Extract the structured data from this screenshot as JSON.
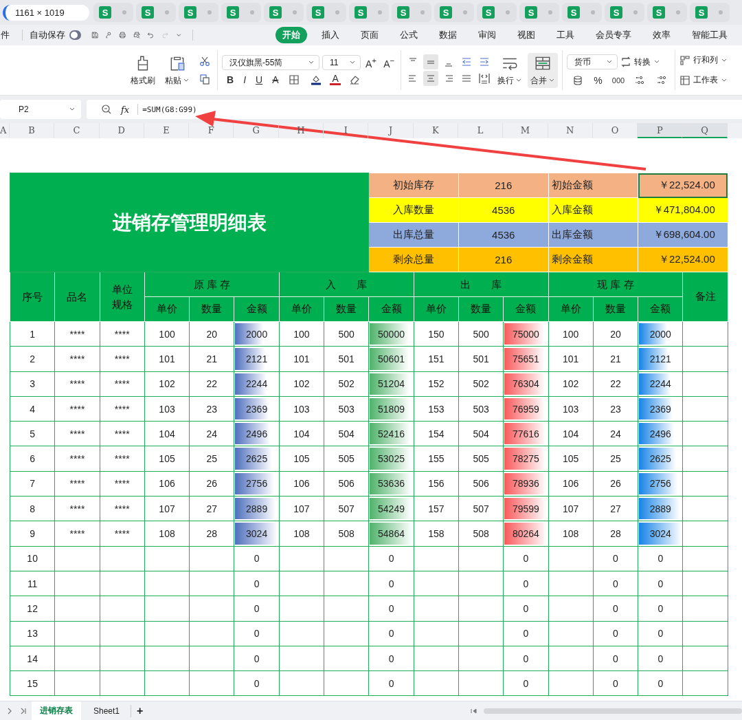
{
  "size_label": "1161 × 1019",
  "browser_tabs": [
    {
      "badge": "S"
    },
    {
      "badge": "S"
    },
    {
      "badge": "S"
    },
    {
      "badge": "S"
    },
    {
      "badge": "S"
    },
    {
      "badge": "S"
    },
    {
      "badge": "S"
    },
    {
      "badge": "S"
    },
    {
      "badge": "S"
    },
    {
      "badge": "S"
    },
    {
      "badge": "S"
    },
    {
      "badge": "S"
    },
    {
      "badge": "S"
    },
    {
      "badge": "S"
    },
    {
      "badge": "S"
    }
  ],
  "file_menu": "件",
  "autosave": {
    "label": "自动保存",
    "on": false
  },
  "menu_tabs": [
    {
      "label": "开始",
      "selected": true
    },
    {
      "label": "插入",
      "selected": false
    },
    {
      "label": "页面",
      "selected": false
    },
    {
      "label": "公式",
      "selected": false
    },
    {
      "label": "数据",
      "selected": false
    },
    {
      "label": "审阅",
      "selected": false
    },
    {
      "label": "视图",
      "selected": false
    },
    {
      "label": "工具",
      "selected": false
    },
    {
      "label": "会员专享",
      "selected": false
    },
    {
      "label": "效率",
      "selected": false
    },
    {
      "label": "智能工具",
      "selected": false
    }
  ],
  "ribbon": {
    "format_painter": "格式刷",
    "paste": "粘贴",
    "font": {
      "family": "汉仪旗黑-55简",
      "size": "11",
      "grow": "A$^{+}$",
      "shrink": "A$^{−}$",
      "bold": "B",
      "italic": "I",
      "underline": "U",
      "strike": "A",
      "color_letter": "A"
    },
    "vertical_align": [
      {
        "selected": false
      },
      {
        "selected": true
      },
      {
        "selected": false
      }
    ],
    "horizontal_align": [
      {
        "selected": false
      },
      {
        "selected": true
      },
      {
        "selected": false
      },
      {
        "selected": false
      }
    ],
    "wrap": "换行",
    "merge": {
      "label": "合并",
      "active": true
    },
    "number": {
      "format": "货币",
      "convert": "转换",
      "percent": "%",
      "thousands": "000"
    },
    "cells": [
      "行和列",
      "工作表"
    ]
  },
  "formula_bar": {
    "name_box": "P2",
    "fx": "fx",
    "formula": "=SUM(G8:G99)"
  },
  "column_headers": [
    {
      "label": "A",
      "selected": false
    },
    {
      "label": "B",
      "selected": false
    },
    {
      "label": "C",
      "selected": false
    },
    {
      "label": "D",
      "selected": false
    },
    {
      "label": "E",
      "selected": false
    },
    {
      "label": "F",
      "selected": false
    },
    {
      "label": "G",
      "selected": false
    },
    {
      "label": "H",
      "selected": false
    },
    {
      "label": "I",
      "selected": false
    },
    {
      "label": "J",
      "selected": false
    },
    {
      "label": "K",
      "selected": false
    },
    {
      "label": "L",
      "selected": false
    },
    {
      "label": "M",
      "selected": false
    },
    {
      "label": "N",
      "selected": false
    },
    {
      "label": "O",
      "selected": false
    },
    {
      "label": "P",
      "selected": true
    },
    {
      "label": "Q",
      "selected": true
    }
  ],
  "title": "进销存管理明细表",
  "summary": [
    {
      "label": "初始库存",
      "value": "216",
      "amount_label": "初始金额",
      "amount": "￥22,524.00",
      "color": "#f4b183",
      "selected": true
    },
    {
      "label": "入库数量",
      "value": "4536",
      "amount_label": "入库金额",
      "amount": "￥471,804.00",
      "color": "#ffff00",
      "selected": false
    },
    {
      "label": "出库总量",
      "value": "4536",
      "amount_label": "出库金额",
      "amount": "￥698,604.00",
      "color": "#8ea9db",
      "selected": false
    },
    {
      "label": "剩余总量",
      "value": "216",
      "amount_label": "剩余金额",
      "amount": "￥22,524.00",
      "color": "#ffc000",
      "selected": false
    }
  ],
  "table": {
    "fixed_headers": [
      "序号",
      "品名",
      "单位规格"
    ],
    "groups": [
      {
        "label": "原 库 存",
        "sub_headers": [
          "单价",
          "数量",
          "金额"
        ]
      },
      {
        "label": "入　　库",
        "sub_headers": [
          "单价",
          "数量",
          "金额"
        ]
      },
      {
        "label": "出　　库",
        "sub_headers": [
          "单价",
          "数量",
          "金额"
        ]
      },
      {
        "label": "现 库 存",
        "sub_headers": [
          "单价",
          "数量",
          "金额"
        ]
      }
    ],
    "remark_header": "备注",
    "rows": [
      {
        "cells": [
          "1",
          "****",
          "****",
          "100",
          "20",
          "2000",
          "100",
          "500",
          "50000",
          "150",
          "500",
          "75000",
          "100",
          "20",
          "2000"
        ]
      },
      {
        "cells": [
          "2",
          "****",
          "****",
          "101",
          "21",
          "2121",
          "101",
          "501",
          "50601",
          "151",
          "501",
          "75651",
          "101",
          "21",
          "2121"
        ]
      },
      {
        "cells": [
          "3",
          "****",
          "****",
          "102",
          "22",
          "2244",
          "102",
          "502",
          "51204",
          "152",
          "502",
          "76304",
          "102",
          "22",
          "2244"
        ]
      },
      {
        "cells": [
          "4",
          "****",
          "****",
          "103",
          "23",
          "2369",
          "103",
          "503",
          "51809",
          "153",
          "503",
          "76959",
          "103",
          "23",
          "2369"
        ]
      },
      {
        "cells": [
          "5",
          "****",
          "****",
          "104",
          "24",
          "2496",
          "104",
          "504",
          "52416",
          "154",
          "504",
          "77616",
          "104",
          "24",
          "2496"
        ]
      },
      {
        "cells": [
          "6",
          "****",
          "****",
          "105",
          "25",
          "2625",
          "105",
          "505",
          "53025",
          "155",
          "505",
          "78275",
          "105",
          "25",
          "2625"
        ]
      },
      {
        "cells": [
          "7",
          "****",
          "****",
          "106",
          "26",
          "2756",
          "106",
          "506",
          "53636",
          "156",
          "506",
          "78936",
          "106",
          "26",
          "2756"
        ]
      },
      {
        "cells": [
          "8",
          "****",
          "****",
          "107",
          "27",
          "2889",
          "107",
          "507",
          "54249",
          "157",
          "507",
          "79599",
          "107",
          "27",
          "2889"
        ]
      },
      {
        "cells": [
          "9",
          "****",
          "****",
          "108",
          "28",
          "3024",
          "108",
          "508",
          "54864",
          "158",
          "508",
          "80264",
          "108",
          "28",
          "3024"
        ]
      },
      {
        "cells": [
          "10",
          null,
          null,
          null,
          null,
          "0",
          null,
          null,
          "0",
          null,
          null,
          "0",
          null,
          "0",
          "0"
        ]
      },
      {
        "cells": [
          "11",
          null,
          null,
          null,
          null,
          "0",
          null,
          null,
          "0",
          null,
          null,
          "0",
          null,
          "0",
          "0"
        ]
      },
      {
        "cells": [
          "12",
          null,
          null,
          null,
          null,
          "0",
          null,
          null,
          "0",
          null,
          null,
          "0",
          null,
          "0",
          "0"
        ]
      },
      {
        "cells": [
          "13",
          null,
          null,
          null,
          null,
          "0",
          null,
          null,
          "0",
          null,
          null,
          "0",
          null,
          "0",
          "0"
        ]
      },
      {
        "cells": [
          "14",
          null,
          null,
          null,
          null,
          "0",
          null,
          null,
          "0",
          null,
          null,
          "0",
          null,
          "0",
          "0"
        ]
      },
      {
        "cells": [
          "15",
          null,
          null,
          null,
          null,
          "0",
          null,
          null,
          "0",
          null,
          null,
          "0",
          null,
          "0",
          "0"
        ]
      }
    ]
  },
  "sheet_tabs": [
    {
      "label": "进销存表",
      "selected": true
    },
    {
      "label": "Sheet1",
      "selected": false
    }
  ],
  "add_sheet": "+"
}
